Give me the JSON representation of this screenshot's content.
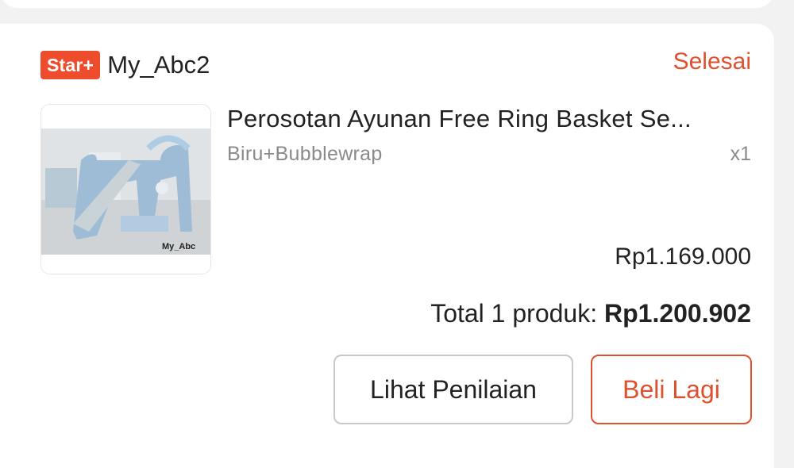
{
  "shop": {
    "badge": "Star+",
    "name": "My_Abc2",
    "status": "Selesai"
  },
  "product": {
    "title": "Perosotan Ayunan Free Ring Basket Se...",
    "variant": "Biru+Bubblewrap",
    "quantity": "x1",
    "price": "Rp1.169.000",
    "image_watermark": "My_Abc"
  },
  "summary": {
    "label": "Total 1 produk:",
    "amount": "Rp1.200.902"
  },
  "actions": {
    "review_label": "Lihat Penilaian",
    "buy_again_label": "Beli Lagi"
  },
  "colors": {
    "accent": "#ee4d2d",
    "status": "#e0502f",
    "background": "#f2f2f2"
  }
}
